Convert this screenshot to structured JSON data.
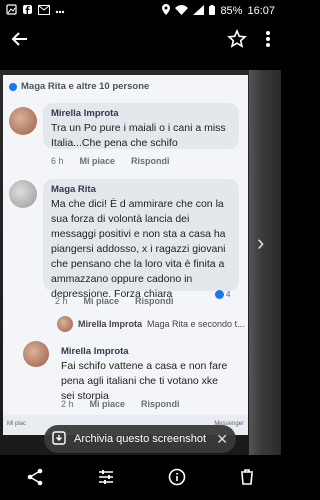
{
  "status_bar": {
    "battery": "85%",
    "time": "16:07"
  },
  "photo": {
    "header": "Maga Rita e altre 10 persone",
    "comments": [
      {
        "author": "Mirella Improta",
        "text": "Tra un Po pure i maiali o i cani a miss Italia...Che pena che schifo",
        "time": "6 h",
        "like": "Mi piace",
        "reply": "Rispondi"
      },
      {
        "author": "Maga Rita",
        "text": "Ma che dici! È d ammirare che con la sua forza di volontà lancia dei messaggi positivi e non sta a casa ha piangersi addosso, x i ragazzi giovani che pensano che la loro vita è finita a ammazzano oppure cadono in depressione. Forza chiara",
        "time": "2 h",
        "like": "Mi piace",
        "reply": "Rispondi",
        "likes": "4"
      },
      {
        "author": "Mirella Improta",
        "text": "Fai schifo vattene a casa e non fare pena agli italiani che ti votano xke sei storpia",
        "time": "2 h",
        "like": "Mi piace",
        "reply": "Rispondi"
      }
    ],
    "reply_preview": {
      "author": "Mirella Improta",
      "text": "Maga Rita e secondo t..."
    },
    "strip_left": "Mi piac",
    "strip_right": "Messenger"
  },
  "archive_chip": {
    "label": "Archivia questo screenshot"
  },
  "icons": {
    "back": "back-arrow-icon",
    "star": "star-icon",
    "more": "more-vert-icon",
    "share": "share-icon",
    "edit": "tune-icon",
    "info": "info-icon",
    "delete": "trash-icon"
  }
}
